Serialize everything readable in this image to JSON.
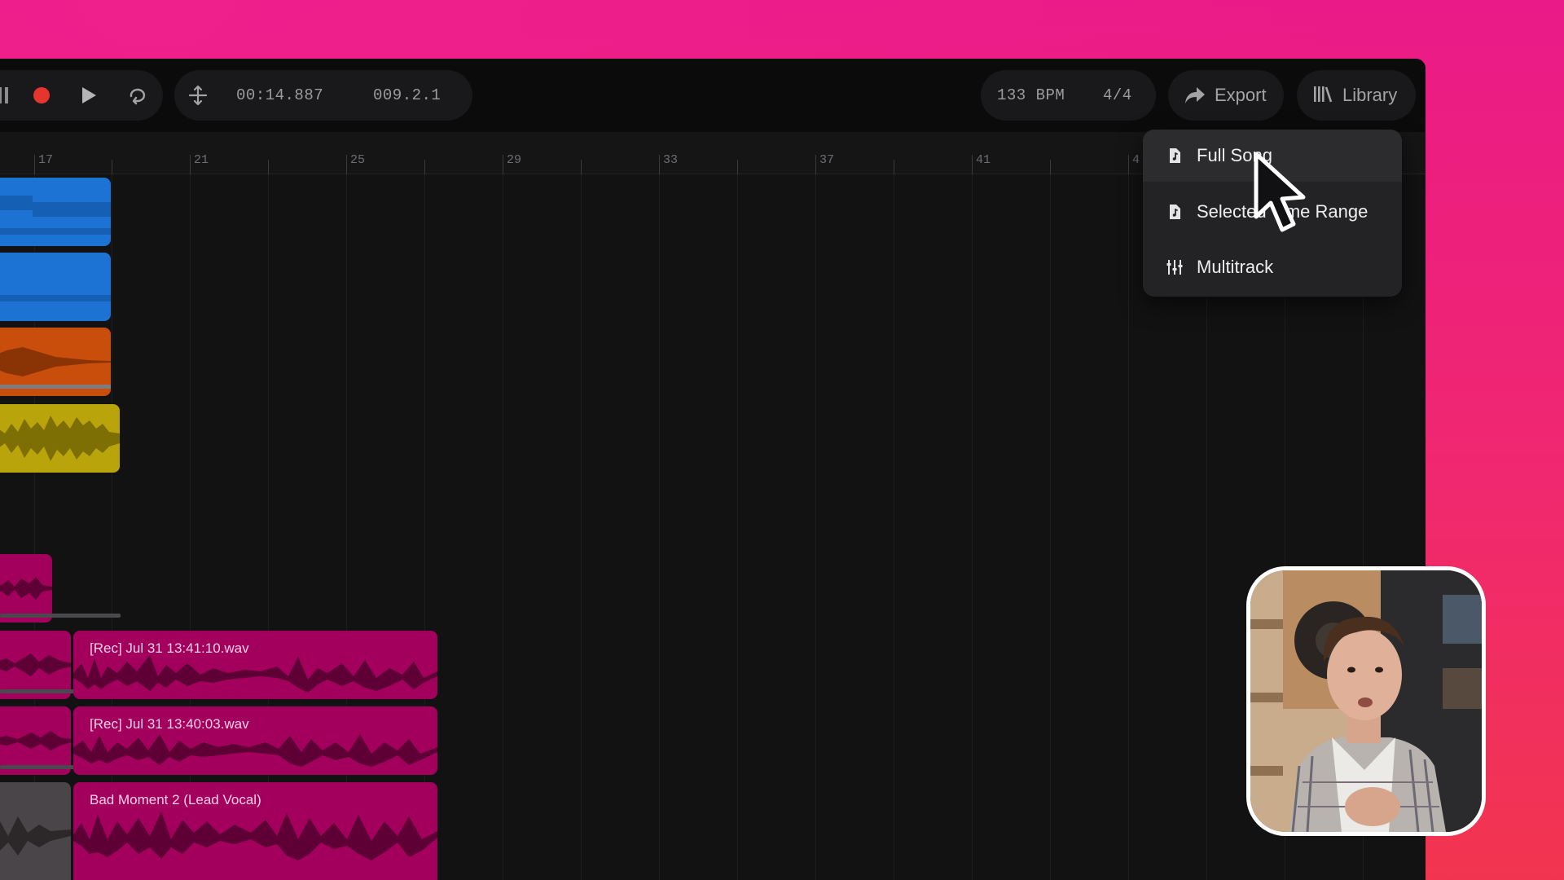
{
  "toolbar": {
    "time": "00:14.887",
    "position": "009.2.1",
    "bpm": "133 BPM",
    "time_signature": "4/4",
    "export_label": "Export",
    "library_label": "Library",
    "record_color": "#e5352e"
  },
  "ruler": {
    "labels": [
      "17",
      "21",
      "25",
      "29",
      "33",
      "37",
      "41",
      "4"
    ]
  },
  "export_menu": {
    "items": [
      {
        "label": "Full Song",
        "icon": "file-audio-icon"
      },
      {
        "label": "Selected Time Range",
        "icon": "file-audio-icon"
      },
      {
        "label": "Multitrack",
        "icon": "sliders-icon"
      }
    ]
  },
  "tracks": {
    "clips": [
      {
        "label": "[Rec] Jul 31 13:41:10.wav",
        "color": "#a3005e"
      },
      {
        "label": "[Rec] Jul 31 13:40:03.wav",
        "color": "#a3005e"
      },
      {
        "label": "Bad Moment 2 (Lead Vocal)",
        "color": "#a3005e"
      }
    ],
    "colors": {
      "blue": "#1d73d3",
      "orange": "#c94e0b",
      "yellow": "#b9a40c",
      "magenta": "#a3005e",
      "gray": "#4a4548"
    }
  }
}
